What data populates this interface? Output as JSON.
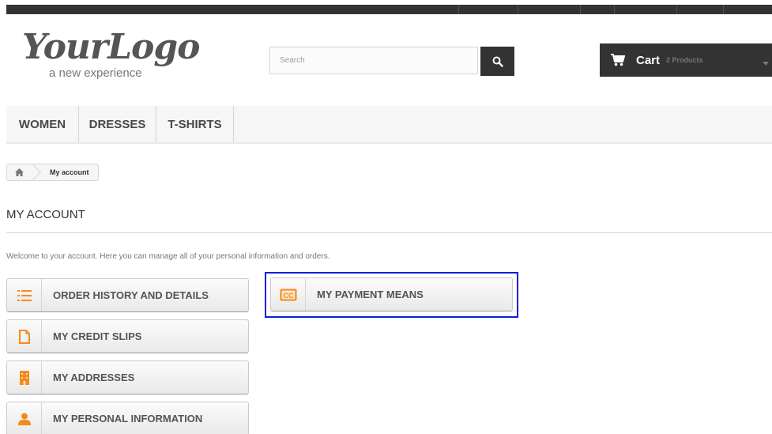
{
  "logo": {
    "name": "YourLogo",
    "tagline": "a new experience"
  },
  "search": {
    "placeholder": "Search",
    "button_icon": "search-icon"
  },
  "cart": {
    "label": "Cart",
    "count": "2 Products",
    "icon": "shopping-cart-icon"
  },
  "menu": {
    "items": [
      {
        "label": "WOMEN"
      },
      {
        "label": "DRESSES"
      },
      {
        "label": "T-SHIRTS"
      }
    ]
  },
  "breadcrumb": {
    "home_icon": "home-icon",
    "current": "My account"
  },
  "page": {
    "title": "MY ACCOUNT",
    "welcome": "Welcome to your account. Here you can manage all of your personal information and orders."
  },
  "account_links": [
    {
      "label": "ORDER HISTORY AND DETAILS",
      "icon": "list-icon"
    },
    {
      "label": "MY CREDIT SLIPS",
      "icon": "file-icon"
    },
    {
      "label": "MY ADDRESSES",
      "icon": "building-icon"
    },
    {
      "label": "MY PERSONAL INFORMATION",
      "icon": "user-icon"
    },
    {
      "label": "MY PAYMENT MEANS",
      "icon": "credit-card-icon"
    }
  ],
  "colors": {
    "accent": "#f38b1f",
    "dark": "#333333",
    "highlight": "#0a1fd6"
  }
}
